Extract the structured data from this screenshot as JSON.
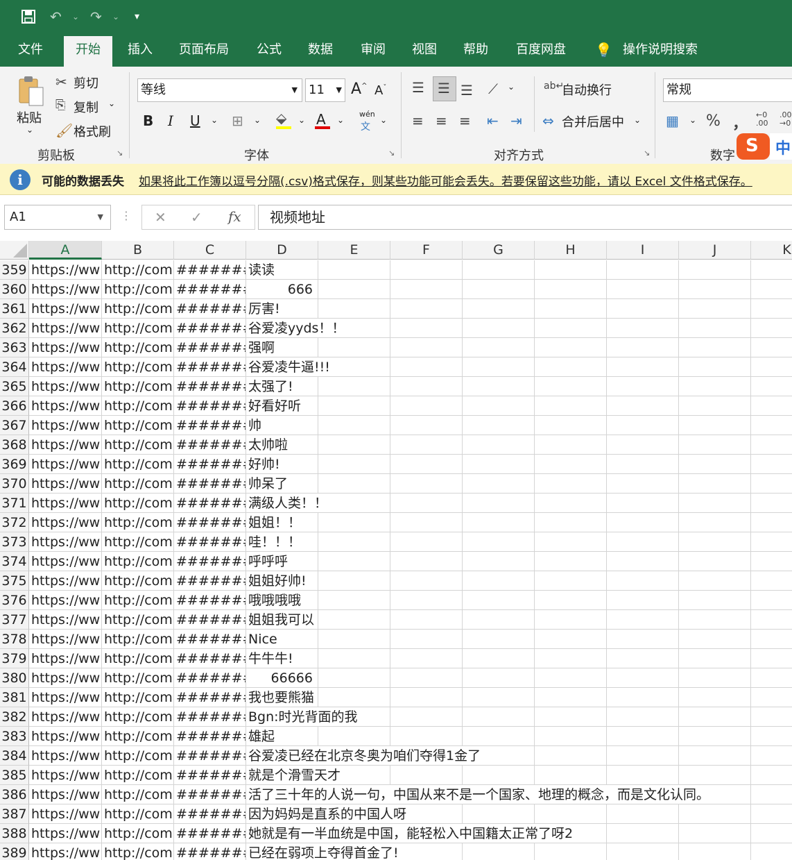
{
  "title_bar": {
    "save_icon": "save-icon",
    "undo_icon": "undo-icon",
    "redo_icon": "redo-icon",
    "customize_icon": "customize-qat-icon"
  },
  "tabs": [
    "文件",
    "开始",
    "插入",
    "页面布局",
    "公式",
    "数据",
    "审阅",
    "视图",
    "帮助",
    "百度网盘"
  ],
  "tell_me": "操作说明搜索",
  "clipboard": {
    "paste": "粘贴",
    "cut": "剪切",
    "copy": "复制",
    "format_painter": "格式刷",
    "group": "剪贴板"
  },
  "font": {
    "name": "等线",
    "size": "11",
    "bold": "B",
    "italic": "I",
    "underline": "U",
    "phonetic_top": "wén",
    "phonetic_bottom": "文",
    "group": "字体"
  },
  "alignment": {
    "wrap_text": "自动换行",
    "merge_center": "合并后居中",
    "group": "对齐方式"
  },
  "number": {
    "format": "常规",
    "percent": "%",
    "comma": "，",
    "group": "数字",
    "inc_decimal": "←0 .00",
    "dec_decimal": ".00 →0"
  },
  "ime": {
    "logo": "S",
    "label": "中"
  },
  "info_bar": {
    "title": "可能的数据丢失",
    "message": "如果将此工作簿以逗号分隔(.csv)格式保存，则某些功能可能会丢失。若要保留这些功能，请以 Excel 文件格式保存。"
  },
  "formula_bar": {
    "name_box": "A1",
    "cancel": "✕",
    "enter": "✓",
    "fx": "fx",
    "content": "视频地址"
  },
  "columns": [
    "A",
    "B",
    "C",
    "D",
    "E",
    "F",
    "G",
    "H",
    "I",
    "J",
    "K"
  ],
  "row_prefix": {
    "a": "https://ww",
    "b": "http://com",
    "c": "#######"
  },
  "rows": [
    {
      "n": "359",
      "d": "读读"
    },
    {
      "n": "360",
      "d": "666",
      "num": true
    },
    {
      "n": "361",
      "d": "厉害!"
    },
    {
      "n": "362",
      "d": "谷爱凌yyds！！"
    },
    {
      "n": "363",
      "d": "强啊"
    },
    {
      "n": "364",
      "d": "谷爱凌牛逼!!!"
    },
    {
      "n": "365",
      "d": "太强了!"
    },
    {
      "n": "366",
      "d": "好看好听"
    },
    {
      "n": "367",
      "d": "帅"
    },
    {
      "n": "368",
      "d": "太帅啦"
    },
    {
      "n": "369",
      "d": "好帅!"
    },
    {
      "n": "370",
      "d": "帅呆了"
    },
    {
      "n": "371",
      "d": "满级人类！！"
    },
    {
      "n": "372",
      "d": "姐姐！！"
    },
    {
      "n": "373",
      "d": "哇！！！"
    },
    {
      "n": "374",
      "d": "呼呼呼"
    },
    {
      "n": "375",
      "d": "姐姐好帅!"
    },
    {
      "n": "376",
      "d": "哦哦哦哦"
    },
    {
      "n": "377",
      "d": "姐姐我可以"
    },
    {
      "n": "378",
      "d": "Nice"
    },
    {
      "n": "379",
      "d": "牛牛牛!"
    },
    {
      "n": "380",
      "d": "66666",
      "num": true
    },
    {
      "n": "381",
      "d": "我也要熊猫"
    },
    {
      "n": "382",
      "d": "Bgn:时光背面的我"
    },
    {
      "n": "383",
      "d": "雄起"
    },
    {
      "n": "384",
      "d": "谷爱凌已经在北京冬奥为咱们夺得1金了"
    },
    {
      "n": "385",
      "d": "就是个滑雪天才"
    },
    {
      "n": "386",
      "d": "活了三十年的人说一句，中国从来不是一个国家、地理的概念，而是文化认同。"
    },
    {
      "n": "387",
      "d": "因为妈妈是直系的中国人呀"
    },
    {
      "n": "388",
      "d": "她就是有一半血统是中国，能轻松入中国籍太正常了呀2"
    },
    {
      "n": "389",
      "d": "已经在弱项上夺得首金了!"
    }
  ],
  "colors": {
    "excel_green": "#217346",
    "info_bg": "#fdf6c4",
    "selection": "#217346"
  }
}
